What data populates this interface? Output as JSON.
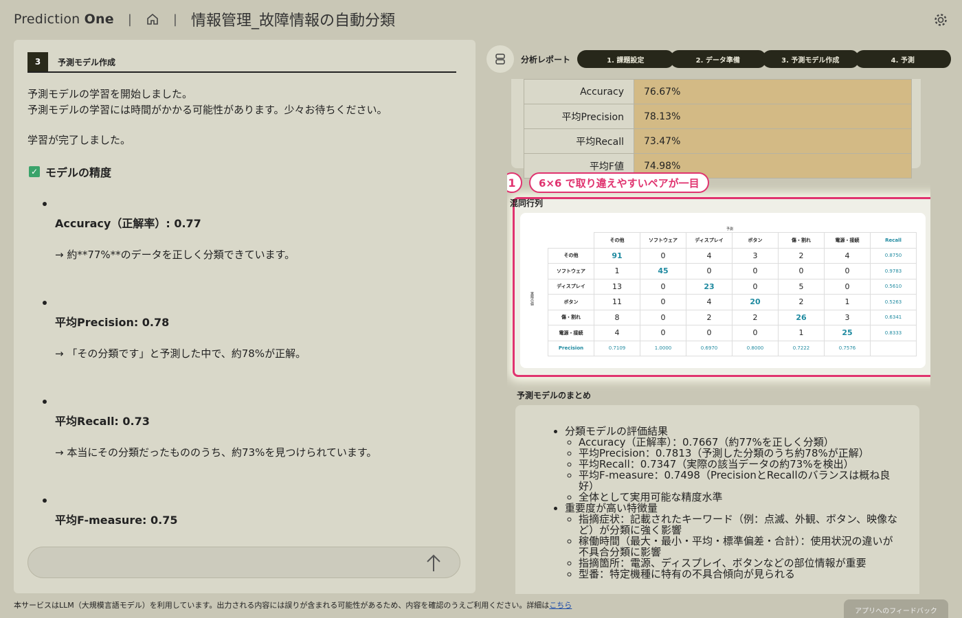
{
  "header": {
    "brand_light": "Prediction ",
    "brand_bold": "One",
    "sep1": "|",
    "sep2": "|",
    "page_title": "情報管理_故障情報の自動分類"
  },
  "left": {
    "step_num": "3",
    "step_label": "予測モデル作成",
    "msg1_line1": "予測モデルの学習を開始しました。",
    "msg1_line2": "予測モデルの学習には時間がかかる可能性があります。少々お待ちください。",
    "msg2": "学習が完了しました。",
    "check_icon": "✓",
    "section_title": "モデルの精度",
    "metrics": [
      {
        "label": "Accuracy（正解率）: 0.77",
        "desc": "→ 約**77%**のデータを正しく分類できています。"
      },
      {
        "label": "平均Precision: 0.78",
        "desc": "→ 「その分類です」と予測した中で、約78%が正解。"
      },
      {
        "label": "平均Recall: 0.73",
        "desc": "→ 本当にその分類だったもののうち、約73%を見つけられています。"
      },
      {
        "label": "平均F-measure: 0.75",
        "desc": ""
      }
    ]
  },
  "right": {
    "report_label": "分析レポート",
    "steps": [
      "1. 課題設定",
      "2. データ準備",
      "3. 予測モデル作成",
      "4. 予測"
    ],
    "metrics_table": [
      {
        "k": "Accuracy",
        "v": "76.67%"
      },
      {
        "k": "平均Precision",
        "v": "78.13%"
      },
      {
        "k": "平均Recall",
        "v": "73.47%"
      },
      {
        "k": "平均F値",
        "v": "74.98%"
      }
    ],
    "callout_num": "1",
    "callout_text": "6×6 で取り違えやすいペアが一目",
    "cm_title": "混同行列",
    "cm_pred_label": "予測",
    "cm_actual_label": "実際の値",
    "cm_headers": [
      "その他",
      "ソフトウェア",
      "ディスプレイ",
      "ボタン",
      "傷・割れ",
      "電源・接続",
      "Recall"
    ],
    "cm_rows": [
      {
        "label": "その他",
        "vals": [
          "91",
          "0",
          "4",
          "3",
          "2",
          "4"
        ],
        "recall": "0.8750"
      },
      {
        "label": "ソフトウェア",
        "vals": [
          "1",
          "45",
          "0",
          "0",
          "0",
          "0"
        ],
        "recall": "0.9783"
      },
      {
        "label": "ディスプレイ",
        "vals": [
          "13",
          "0",
          "23",
          "0",
          "5",
          "0"
        ],
        "recall": "0.5610"
      },
      {
        "label": "ボタン",
        "vals": [
          "11",
          "0",
          "4",
          "20",
          "2",
          "1"
        ],
        "recall": "0.5263"
      },
      {
        "label": "傷・割れ",
        "vals": [
          "8",
          "0",
          "2",
          "2",
          "26",
          "3"
        ],
        "recall": "0.6341"
      },
      {
        "label": "電源・接続",
        "vals": [
          "4",
          "0",
          "0",
          "0",
          "1",
          "25"
        ],
        "recall": "0.8333"
      }
    ],
    "cm_precision_label": "Precision",
    "cm_precision": [
      "0.7109",
      "1.0000",
      "0.6970",
      "0.8000",
      "0.7222",
      "0.7576"
    ],
    "summary_title": "予測モデルのまとめ",
    "summary": {
      "item1": "分類モデルの評価結果",
      "item1_subs": [
        "Accuracy（正解率）：0.7667（約77%を正しく分類）",
        "平均Precision：0.7813（予測した分類のうち約78%が正解）",
        "平均Recall：0.7347（実際の該当データの約73%を検出）",
        "平均F-measure：0.7498（PrecisionとRecallのバランスは概ね良好）",
        "全体として実用可能な精度水準"
      ],
      "item2": "重要度が高い特徴量",
      "item2_subs": [
        "指摘症状：記載されたキーワード（例：点滅、外観、ボタン、映像など）が分類に強く影響",
        "稼働時間（最大・最小・平均・標準偏差・合計）：使用状況の違いが不具合分類に影響",
        "指摘箇所：電源、ディスプレイ、ボタンなどの部位情報が重要",
        "型番：特定機種に特有の不具合傾向が見られる"
      ]
    }
  },
  "footer": {
    "text": "本サービスはLLM（大規模言語モデル）を利用しています。出力される内容には誤りが含まれる可能性があるため、内容を確認のうえご利用ください。詳細は",
    "link": "こちら",
    "feedback": "アプリへのフィードバック"
  }
}
